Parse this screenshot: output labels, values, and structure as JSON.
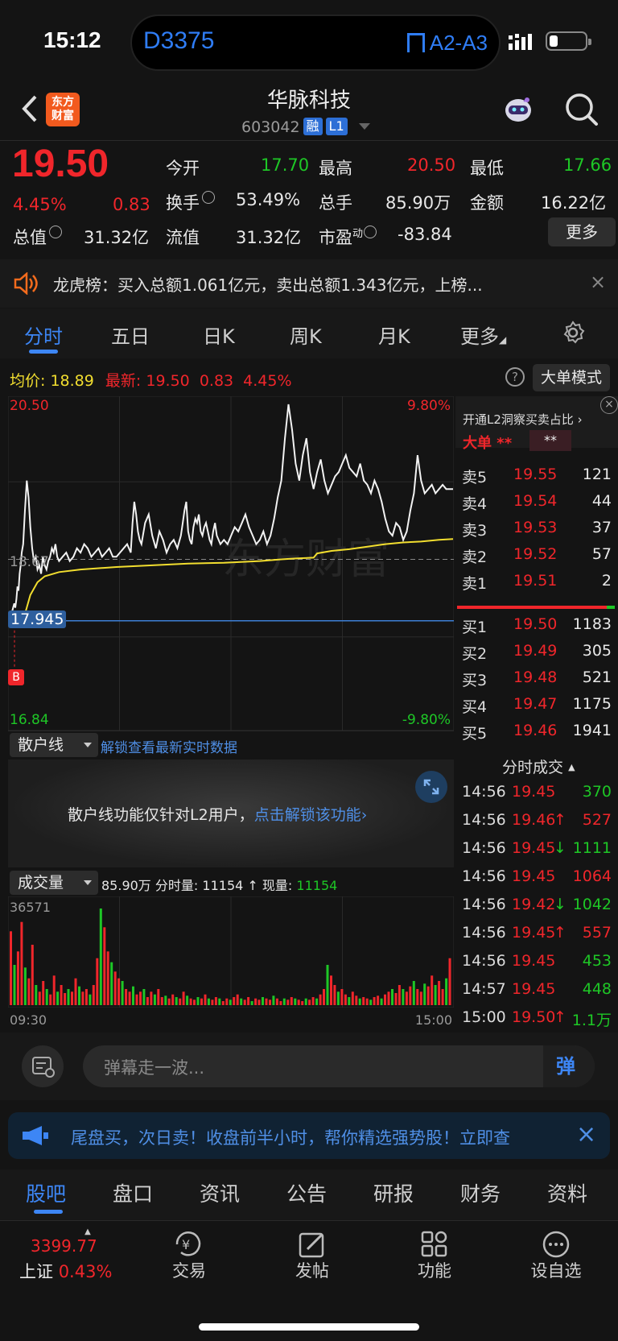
{
  "status_bar": {
    "time": "15:12",
    "train": "D3375",
    "platform": "A2-A3"
  },
  "header": {
    "logo_line1": "东方",
    "logo_line2": "财富",
    "stock_name": "华脉科技",
    "stock_code": "603042",
    "tag_margin": "融",
    "tag_level": "L1"
  },
  "quote": {
    "price": "19.50",
    "change_pct": "4.45%",
    "change": "0.83",
    "open_label": "今开",
    "open": "17.70",
    "high_label": "最高",
    "high": "20.50",
    "low_label": "最低",
    "low": "17.66",
    "turnover_label": "换手",
    "turnover": "53.49%",
    "volume_label": "总手",
    "volume": "85.90万",
    "amount_label": "金额",
    "amount": "16.22亿",
    "mktcap_label": "总值",
    "mktcap": "31.32亿",
    "float_label": "流值",
    "float_cap": "31.32亿",
    "pe_label": "市盈",
    "pe_sup": "动",
    "pe": "-83.84",
    "more_label": "更多"
  },
  "banner": {
    "text": "龙虎榜：买入总额1.061亿元，卖出总额1.343亿元，上榜..."
  },
  "chart_tabs": [
    "分时",
    "五日",
    "日K",
    "周K",
    "月K",
    "更多"
  ],
  "chart_info": {
    "avg_label": "均价:",
    "avg": "18.89",
    "latest_label": "最新:",
    "latest": "19.50",
    "chg": "0.83",
    "pct": "4.45%",
    "mode_button": "大单模式"
  },
  "chart_data": {
    "type": "line",
    "price_axis": {
      "top": "20.50",
      "mid": "18.67",
      "bottom": "16.84",
      "top_pct": "9.80%",
      "bottom_pct": "-9.80%"
    },
    "marker_price": "17.945",
    "marker_label": "B",
    "ylim": [
      16.84,
      20.5
    ],
    "series": [
      {
        "type": "price",
        "x": [
          0,
          3,
          6,
          9,
          12,
          15,
          18,
          21,
          24,
          27,
          30,
          33,
          36,
          40,
          45,
          50,
          55,
          60,
          65,
          70,
          75,
          80,
          85,
          90,
          95,
          100,
          105,
          110,
          115,
          120,
          125,
          130,
          135,
          140,
          150,
          160,
          170,
          180,
          190,
          200,
          210,
          220,
          230,
          240,
          250,
          260,
          270,
          280,
          290,
          300,
          310,
          320,
          330,
          340,
          345,
          350,
          355,
          360,
          365,
          370,
          380,
          390,
          400,
          410,
          420,
          430,
          440,
          450,
          460,
          470,
          480,
          485,
          490,
          495,
          500,
          505,
          510,
          515,
          520,
          525,
          530,
          535,
          540,
          545,
          550,
          555,
          560,
          565,
          570,
          575,
          580,
          590,
          600,
          610,
          620,
          630,
          640,
          650,
          660,
          670,
          680,
          690,
          700,
          710,
          720,
          730,
          740,
          750,
          760,
          770,
          780,
          790,
          800,
          810,
          820,
          830,
          840,
          850,
          860,
          870,
          880,
          890,
          900,
          910,
          920,
          930,
          940,
          950,
          960,
          970,
          980,
          990,
          1000,
          1010,
          1020,
          1030,
          1040,
          1050,
          1060,
          1070,
          1080,
          1090,
          1100,
          1110,
          1120,
          1130,
          1140,
          1150,
          1160,
          1170,
          1180,
          1190,
          1200,
          1210,
          1220,
          1230,
          1239
        ],
        "y": [
          17.9,
          18.0,
          17.95,
          18.05,
          18.1,
          18.15,
          18.1,
          18.2,
          18.35,
          18.3,
          18.5,
          18.6,
          18.75,
          18.85,
          19.25,
          19.6,
          19.4,
          19.05,
          18.8,
          18.65,
          18.7,
          18.55,
          18.6,
          18.5,
          18.7,
          18.6,
          18.55,
          18.65,
          18.7,
          18.8,
          18.75,
          18.85,
          18.7,
          18.65,
          18.7,
          18.75,
          18.65,
          18.7,
          18.8,
          18.75,
          18.85,
          18.8,
          18.7,
          18.75,
          18.8,
          18.7,
          18.75,
          18.8,
          18.7,
          18.7,
          18.75,
          18.8,
          18.85,
          18.75,
          19.1,
          19.35,
          19.2,
          19.0,
          18.9,
          18.85,
          19.1,
          19.2,
          18.95,
          18.8,
          19.0,
          18.9,
          18.75,
          18.85,
          18.9,
          18.8,
          18.95,
          19.1,
          19.25,
          19.35,
          19.0,
          18.9,
          18.85,
          19.05,
          19.15,
          19.1,
          19.2,
          19.0,
          18.95,
          19.05,
          19.1,
          19.0,
          18.9,
          18.85,
          19.0,
          19.1,
          18.95,
          18.85,
          18.9,
          18.85,
          18.95,
          19.05,
          19.0,
          19.1,
          19.2,
          19.05,
          18.95,
          18.85,
          18.9,
          19.0,
          18.85,
          18.95,
          19.15,
          19.4,
          19.6,
          20.1,
          20.5,
          20.2,
          19.8,
          19.6,
          19.9,
          20.1,
          19.7,
          19.5,
          19.7,
          19.85,
          19.6,
          19.45,
          19.55,
          19.65,
          19.7,
          19.8,
          19.9,
          19.75,
          19.7,
          19.65,
          19.8,
          19.6,
          19.55,
          19.45,
          19.6,
          19.5,
          19.35,
          19.15,
          19.0,
          18.95,
          19.1,
          19.05,
          18.9,
          19.0,
          19.25,
          19.45,
          19.9,
          19.6,
          19.45,
          19.5,
          19.55,
          19.45,
          19.5,
          19.55,
          19.5,
          19.5,
          19.5
        ]
      },
      {
        "type": "avg",
        "x": [
          40,
          60,
          80,
          100,
          140,
          200,
          300,
          400,
          500,
          600,
          700,
          760,
          800,
          850,
          860,
          900,
          950,
          1000,
          1050,
          1100,
          1150,
          1200,
          1239
        ],
        "y": [
          17.95,
          18.25,
          18.4,
          18.47,
          18.52,
          18.55,
          18.58,
          18.6,
          18.62,
          18.63,
          18.65,
          18.67,
          18.68,
          18.69,
          18.74,
          18.77,
          18.79,
          18.82,
          18.85,
          18.87,
          18.88,
          18.9,
          18.91
        ]
      }
    ],
    "volume": {
      "max_label": "36571",
      "x_start": "09:30",
      "x_end": "15:00",
      "bars": [
        0.55,
        0.3,
        0.4,
        0.62,
        0.28,
        0.2,
        0.45,
        0.15,
        0.1,
        0.18,
        0.12,
        0.08,
        0.22,
        0.1,
        0.15,
        0.09,
        0.12,
        0.1,
        0.2,
        0.14,
        0.1,
        0.12,
        0.08,
        0.15,
        0.35,
        0.72,
        0.58,
        0.4,
        0.32,
        0.25,
        0.2,
        0.18,
        0.12,
        0.1,
        0.14,
        0.08,
        0.1,
        0.12,
        0.06,
        0.1,
        0.08,
        0.12,
        0.06,
        0.07,
        0.05,
        0.08,
        0.06,
        0.05,
        0.1,
        0.07,
        0.05,
        0.04,
        0.06,
        0.05,
        0.08,
        0.05,
        0.04,
        0.06,
        0.05,
        0.03,
        0.05,
        0.04,
        0.06,
        0.08,
        0.05,
        0.04,
        0.06,
        0.03,
        0.05,
        0.04,
        0.06,
        0.05,
        0.04,
        0.07,
        0.05,
        0.03,
        0.05,
        0.04,
        0.06,
        0.05,
        0.04,
        0.03,
        0.05,
        0.04,
        0.06,
        0.05,
        0.08,
        0.12,
        0.3,
        0.22,
        0.15,
        0.1,
        0.12,
        0.08,
        0.06,
        0.1,
        0.07,
        0.05,
        0.06,
        0.05,
        0.04,
        0.06,
        0.07,
        0.05,
        0.08,
        0.1,
        0.12,
        0.09,
        0.15,
        0.12,
        0.1,
        0.14,
        0.18,
        0.12,
        0.1,
        0.16,
        0.14,
        0.22,
        0.15,
        0.18,
        0.12,
        0.2,
        0.35
      ],
      "total": "85.90万",
      "period_label": "分时量:",
      "period_value": "11154",
      "current_label": "现量:",
      "current_value": "11154"
    }
  },
  "retail_line": {
    "select_label": "散户线",
    "unlock_text": "解锁查看最新实时数据",
    "panel_text": "散户线功能仅针对L2用户，",
    "panel_link": "点击解锁该功能"
  },
  "volume_select": "成交量",
  "orderbook": {
    "l2_promo": "开通L2洞察买卖占比",
    "big_order_label": "大单",
    "masked1": "**",
    "masked2": "**",
    "asks": [
      {
        "label": "卖5",
        "price": "19.55",
        "qty": "121"
      },
      {
        "label": "卖4",
        "price": "19.54",
        "qty": "44"
      },
      {
        "label": "卖3",
        "price": "19.53",
        "qty": "37"
      },
      {
        "label": "卖2",
        "price": "19.52",
        "qty": "57"
      },
      {
        "label": "卖1",
        "price": "19.51",
        "qty": "2"
      }
    ],
    "bids": [
      {
        "label": "买1",
        "price": "19.50",
        "qty": "1183"
      },
      {
        "label": "买2",
        "price": "19.49",
        "qty": "305"
      },
      {
        "label": "买3",
        "price": "19.48",
        "qty": "521"
      },
      {
        "label": "买4",
        "price": "19.47",
        "qty": "1175"
      },
      {
        "label": "买5",
        "price": "19.46",
        "qty": "1941"
      }
    ],
    "ticks_title": "分时成交",
    "ticks": [
      {
        "time": "14:56",
        "price": "19.45",
        "arrow": "",
        "qty": "370",
        "qty_color": "green"
      },
      {
        "time": "14:56",
        "price": "19.46",
        "arrow": "↑",
        "qty": "527",
        "qty_color": "red"
      },
      {
        "time": "14:56",
        "price": "19.45",
        "arrow": "↓",
        "qty": "1111",
        "qty_color": "green"
      },
      {
        "time": "14:56",
        "price": "19.45",
        "arrow": "",
        "qty": "1064",
        "qty_color": "red"
      },
      {
        "time": "14:56",
        "price": "19.42",
        "arrow": "↓",
        "qty": "1042",
        "qty_color": "green"
      },
      {
        "time": "14:56",
        "price": "19.45",
        "arrow": "↑",
        "qty": "557",
        "qty_color": "red"
      },
      {
        "time": "14:56",
        "price": "19.45",
        "arrow": "",
        "qty": "453",
        "qty_color": "green"
      },
      {
        "time": "14:57",
        "price": "19.45",
        "arrow": "",
        "qty": "448",
        "qty_color": "green"
      },
      {
        "time": "15:00",
        "price": "19.50",
        "arrow": "↑",
        "qty": "1.1万",
        "qty_color": "green"
      }
    ]
  },
  "danmu": {
    "placeholder": "弹幕走一波...",
    "button": "弹"
  },
  "ad": {
    "text": "尾盘买，次日卖！收盘前半小时，帮你精选强势股！立即查"
  },
  "bottom_tabs": [
    "股吧",
    "盘口",
    "资讯",
    "公告",
    "研报",
    "财务",
    "资料"
  ],
  "bottom_nav": {
    "index_value": "3399.77",
    "index_name": "上证",
    "index_pct": "0.43%",
    "items": [
      {
        "label": "交易"
      },
      {
        "label": "发帖"
      },
      {
        "label": "功能"
      },
      {
        "label": "设自选"
      }
    ]
  }
}
